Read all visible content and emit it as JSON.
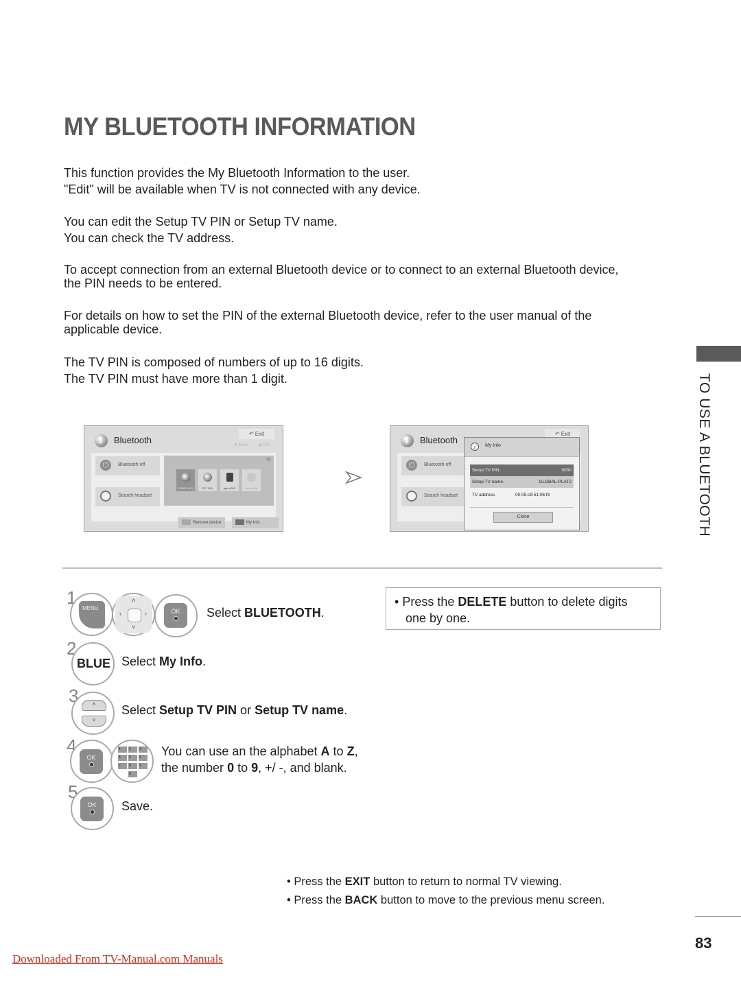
{
  "page": {
    "title": "MY BLUETOOTH INFORMATION",
    "paragraphs": [
      [
        "This function provides the My Bluetooth Information to the user.",
        "\"Edit\" will be available when TV is not connected with any device."
      ],
      [
        "You can edit the Setup TV PIN or Setup TV name.",
        "You can check the TV address."
      ],
      [
        "To accept connection from an external Bluetooth device or to connect to an external Bluetooth device,",
        "the PIN needs to be entered."
      ],
      [
        "For details on how to set the PIN of the external Bluetooth device, refer to the user manual of the",
        "applicable device."
      ],
      [
        "The TV PIN is composed of numbers of up to 16 digits.",
        "The TV PIN must have more than 1 digit."
      ]
    ],
    "side_label": "TO USE A BLUETOOTH",
    "page_number": "83",
    "download_link": "Downloaded From TV-Manual.com Manuals"
  },
  "screen1": {
    "title": "Bluetooth",
    "exit": "Exit",
    "hint_move": "Move",
    "hint_ok": "OK",
    "buttons": [
      {
        "label": "Bluetooth off",
        "icon": "power-icon"
      },
      {
        "label": "Search headset",
        "icon": "search-icon"
      }
    ],
    "page_indicator": "1/1",
    "devices": [
      {
        "label": "DR-BT140Q",
        "icon": "headset-icon",
        "selected": true
      },
      {
        "label": "PLT 510",
        "icon": "headset-icon",
        "selected": false
      },
      {
        "label": "sgh-e760",
        "icon": "phone-icon",
        "selected": false
      },
      {
        "label": "No device",
        "icon": "bluetooth-icon",
        "selected": false
      }
    ],
    "footer": [
      {
        "label": "Remove device",
        "color": "#a8a8a8"
      },
      {
        "label": "My Info",
        "color": "#6e6e6e"
      }
    ]
  },
  "screen2": {
    "title": "Bluetooth",
    "exit": "Exit",
    "buttons": [
      {
        "label": "Bluetooth off",
        "icon": "power-icon"
      },
      {
        "label": "Search headset",
        "icon": "search-icon"
      }
    ],
    "popup": {
      "title": "My Info",
      "rows": [
        {
          "label": "Setup TV PIN.",
          "value": "0000"
        },
        {
          "label": "Setup TV name.",
          "value": "GLOBAL-PLAT2"
        },
        {
          "label": "TV address",
          "value": "00:05:c9:51:06:f3"
        }
      ],
      "close": "Close"
    }
  },
  "steps": [
    {
      "number": "1",
      "keys": [
        "MENU",
        "navigation",
        "OK"
      ],
      "text_plain": "Select ",
      "text_bold": "BLUETOOTH",
      "text_end": "."
    },
    {
      "number": "2",
      "keys": [
        "BLUE"
      ],
      "text_plain": "Select ",
      "text_bold": "My Info",
      "text_end": "."
    },
    {
      "number": "3",
      "keys": [
        "up-down"
      ],
      "text_plain": "Select ",
      "text_bold": "Setup TV PIN",
      "text_mid": " or ",
      "text_bold2": "Setup TV name",
      "text_end": "."
    },
    {
      "number": "4",
      "keys": [
        "OK",
        "number-pad"
      ],
      "line1_a": "You can use an the alphabet ",
      "line1_b": "A",
      "line1_c": " to ",
      "line1_d": "Z",
      "line1_e": ",",
      "line2_a": "the number ",
      "line2_b": "0",
      "line2_c": " to ",
      "line2_d": "9",
      "line2_e": ", +/ -, and blank."
    },
    {
      "number": "5",
      "keys": [
        "OK"
      ],
      "text_plain": "Save."
    }
  ],
  "keys": {
    "menu": "MENU",
    "ok": "OK",
    "blue": "BLUE",
    "numpad": [
      "1",
      "2",
      "3",
      "4",
      "5",
      "6",
      "7",
      "8",
      "9",
      "0"
    ]
  },
  "note": {
    "a": "Press the ",
    "b": "DELETE",
    "c": " button to delete digits",
    "d": "one by one."
  },
  "bottom_notes": [
    {
      "a": "Press the ",
      "b": "EXIT",
      "c": " button to return to normal TV viewing."
    },
    {
      "a": "Press the ",
      "b": "BACK",
      "c": " button to move to the previous menu screen."
    }
  ]
}
